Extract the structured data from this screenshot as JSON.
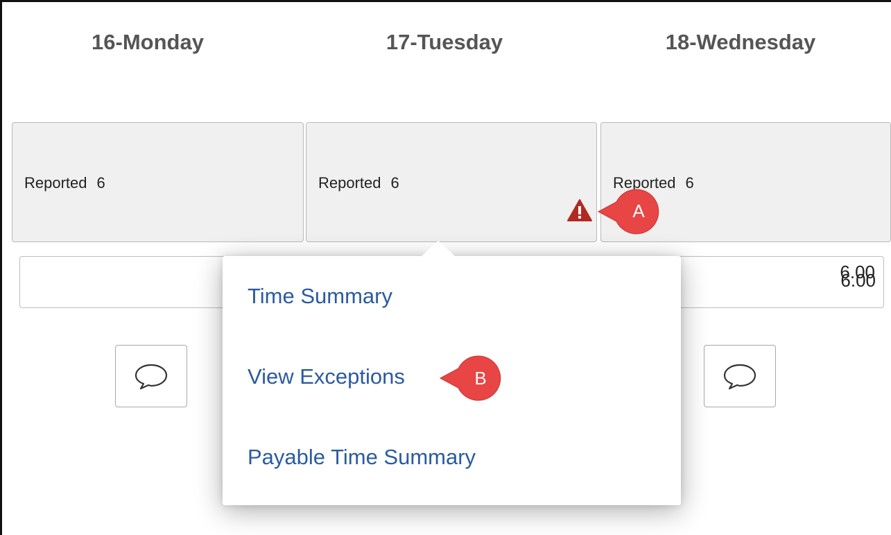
{
  "days": [
    {
      "header": "16-Monday",
      "reported_label": "Reported",
      "reported_value": "6",
      "hours": ""
    },
    {
      "header": "17-Tuesday",
      "reported_label": "Reported",
      "reported_value": "6",
      "hours": ""
    },
    {
      "header": "18-Wednesday",
      "reported_label": "Reported",
      "reported_value": "6",
      "hours": "6.00"
    }
  ],
  "popup_menu": {
    "items": [
      "Time Summary",
      "View Exceptions",
      "Payable Time Summary"
    ]
  },
  "callouts": {
    "a": "A",
    "b": "B"
  },
  "colors": {
    "link": "#2b5ba0",
    "warning": "#b02a21",
    "callout": "#e84545",
    "cell_bg": "#f0f0f0"
  },
  "icons": {
    "warning": "warning-triangle-icon",
    "comment": "speech-bubble-icon"
  }
}
